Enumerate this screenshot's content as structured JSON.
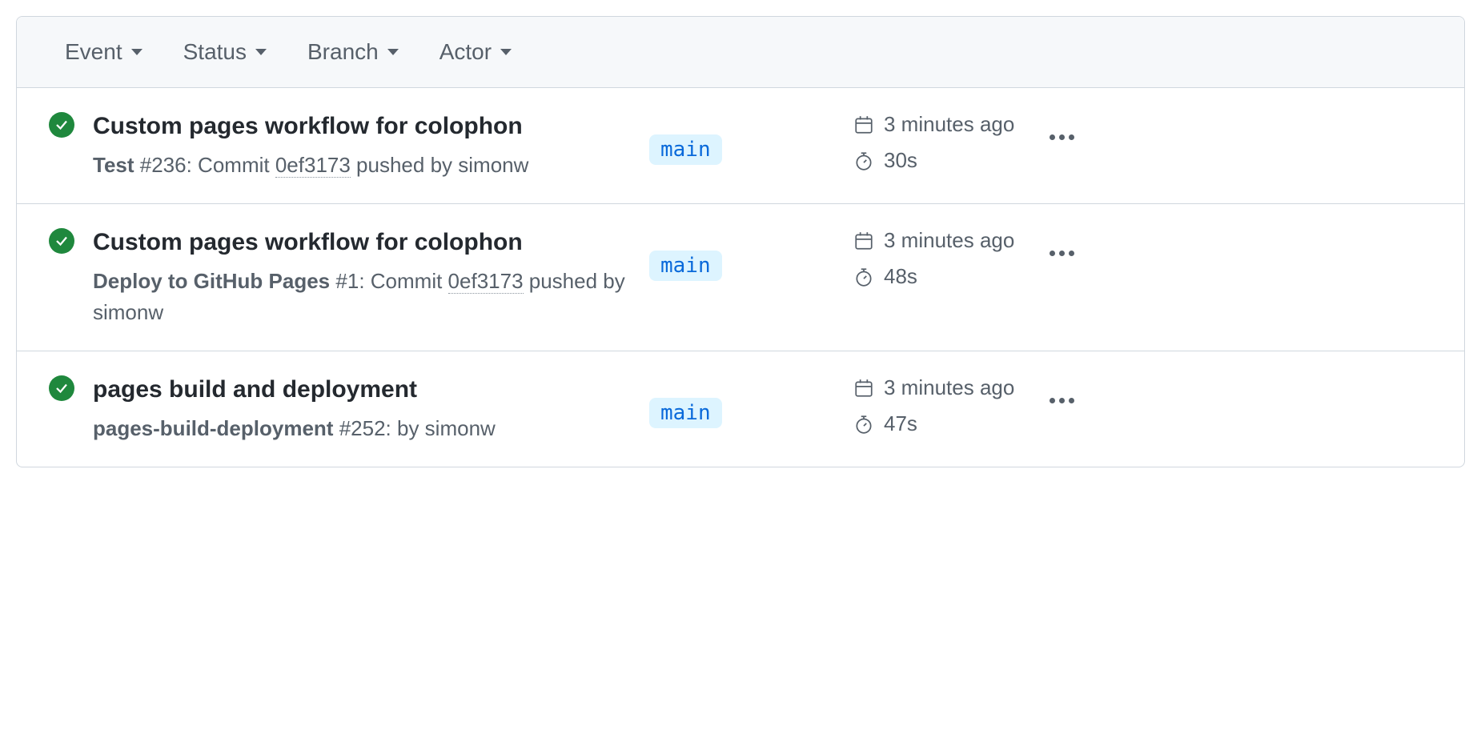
{
  "filters": {
    "event": "Event",
    "status": "Status",
    "branch": "Branch",
    "actor": "Actor"
  },
  "runs": [
    {
      "title": "Custom pages workflow for colophon",
      "workflow": "Test",
      "run_number": "#236",
      "sub_prefix": ": Commit ",
      "commit": "0ef3173",
      "sub_suffix": " pushed by simonw",
      "branch": "main",
      "time_ago": "3 minutes ago",
      "duration": "30s"
    },
    {
      "title": "Custom pages workflow for colophon",
      "workflow": "Deploy to GitHub Pages",
      "run_number": "#1",
      "sub_prefix": ": Commit ",
      "commit": "0ef3173",
      "sub_suffix": " pushed by simonw",
      "branch": "main",
      "time_ago": "3 minutes ago",
      "duration": "48s"
    },
    {
      "title": "pages build and deployment",
      "workflow": "pages-build-deployment",
      "run_number": "#252",
      "sub_prefix": ": by simonw",
      "commit": "",
      "sub_suffix": "",
      "branch": "main",
      "time_ago": "3 minutes ago",
      "duration": "47s"
    }
  ]
}
